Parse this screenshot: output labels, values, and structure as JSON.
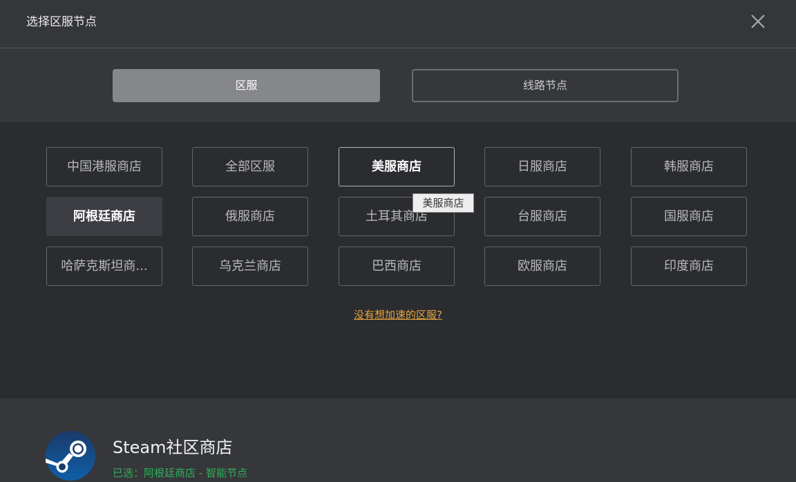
{
  "dialog": {
    "title": "选择区服节点"
  },
  "tabs": [
    {
      "label": "区服",
      "active": true
    },
    {
      "label": "线路节点",
      "active": false
    }
  ],
  "regions": [
    {
      "label": "中国港服商店",
      "state": "normal"
    },
    {
      "label": "全部区服",
      "state": "normal"
    },
    {
      "label": "美服商店",
      "state": "hovered"
    },
    {
      "label": "日服商店",
      "state": "normal"
    },
    {
      "label": "韩服商店",
      "state": "normal"
    },
    {
      "label": "阿根廷商店",
      "state": "selected"
    },
    {
      "label": "俄服商店",
      "state": "normal"
    },
    {
      "label": "土耳其商店",
      "state": "normal"
    },
    {
      "label": "台服商店",
      "state": "normal"
    },
    {
      "label": "国服商店",
      "state": "normal"
    },
    {
      "label": "哈萨克斯坦商...",
      "state": "normal"
    },
    {
      "label": "乌克兰商店",
      "state": "normal"
    },
    {
      "label": "巴西商店",
      "state": "normal"
    },
    {
      "label": "欧服商店",
      "state": "normal"
    },
    {
      "label": "印度商店",
      "state": "normal"
    }
  ],
  "tooltip": {
    "text": "美服商店"
  },
  "help_link": {
    "label": "没有想加速的区服?"
  },
  "footer": {
    "game_name": "Steam社区商店",
    "status": "已选：阿根廷商店 - 智能节点",
    "logo_icon": "steam-logo-icon"
  },
  "colors": {
    "background": "#2b2c30",
    "panel": "#36373b",
    "active_tab": "#86878b",
    "link": "#e9a53a",
    "status_green": "#2fb05a"
  }
}
